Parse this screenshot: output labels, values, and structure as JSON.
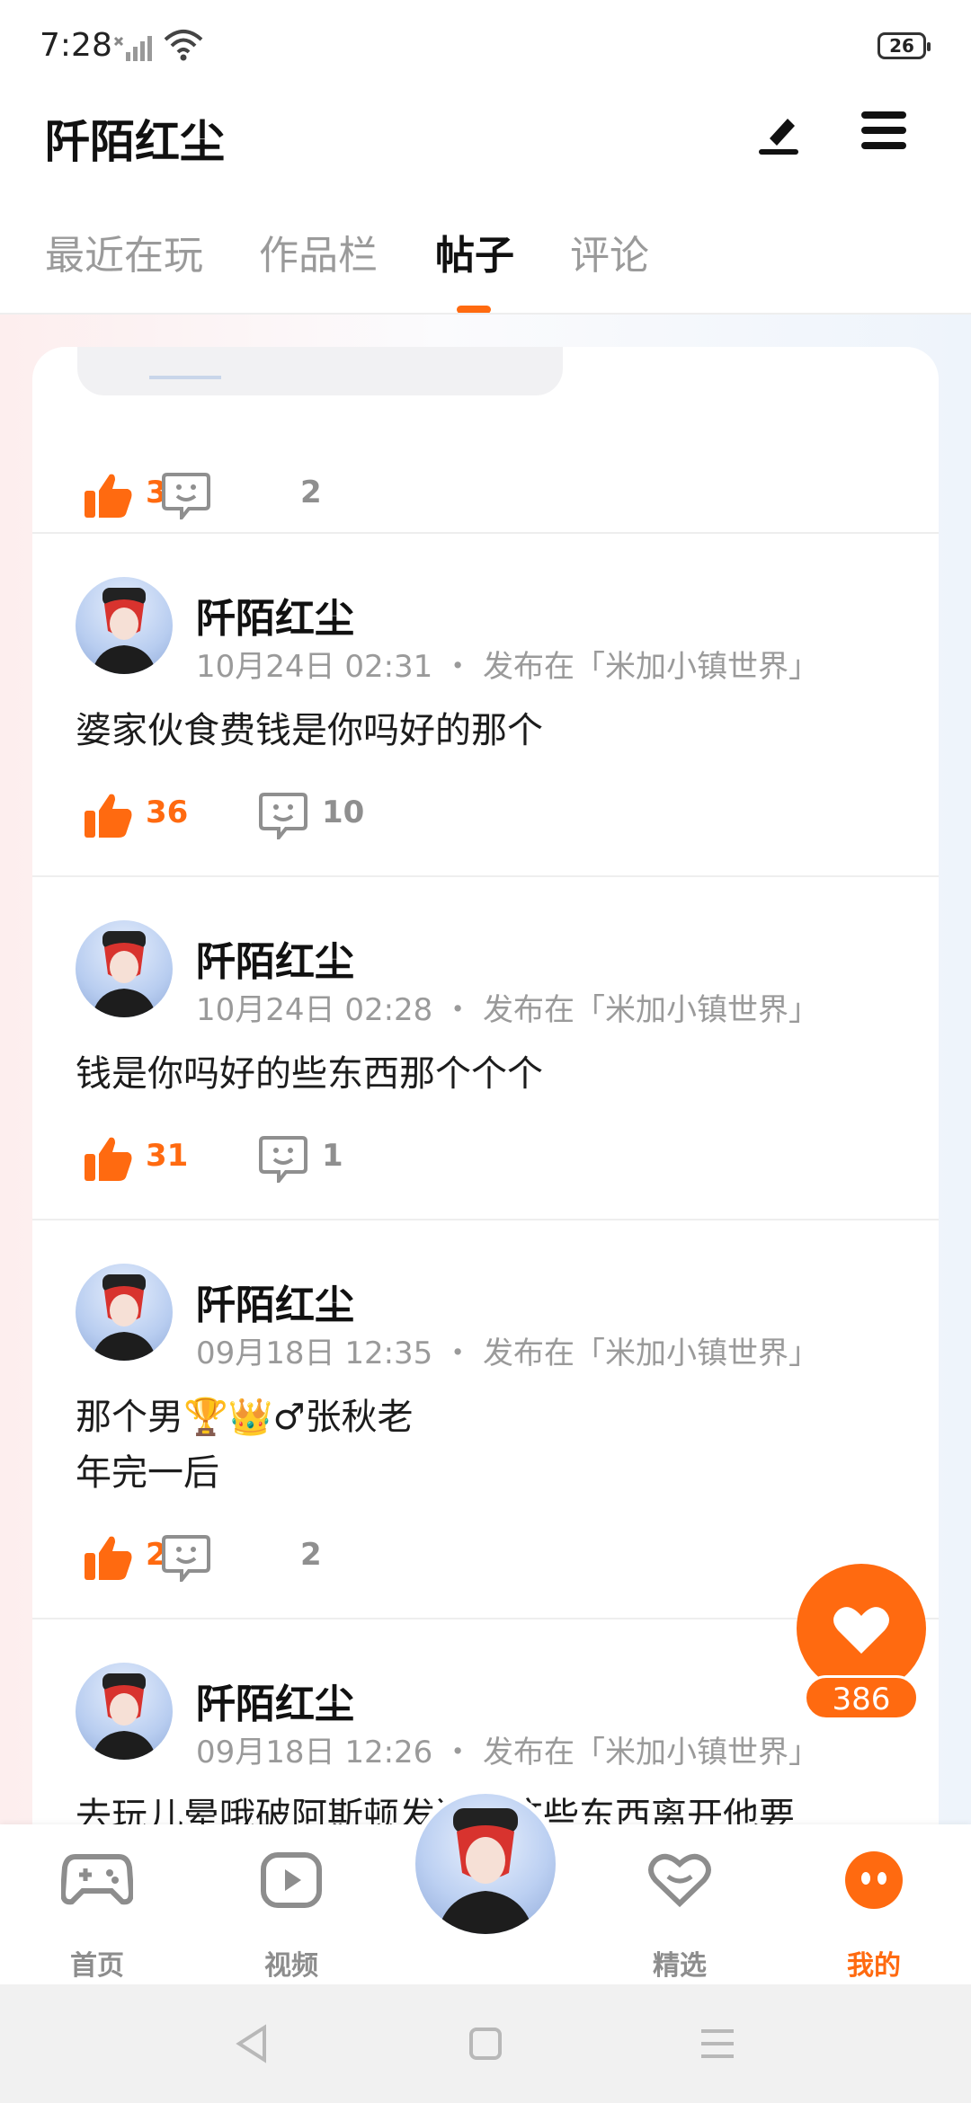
{
  "status_bar": {
    "time": "7:28",
    "battery": "26"
  },
  "header": {
    "title": "阡陌红尘"
  },
  "tabs": [
    {
      "label": "最近在玩"
    },
    {
      "label": "作品栏"
    },
    {
      "label": "帖子"
    },
    {
      "label": "评论"
    }
  ],
  "top_stub": {
    "likes": "3",
    "comments": "2"
  },
  "posts": [
    {
      "author": "阡陌红尘",
      "date": "10月24日 02:31",
      "sep": "・",
      "posted_in": "发布在「米加小镇世界」",
      "lines": [
        "婆家伙食费钱是你吗好的那个"
      ],
      "likes": "36",
      "comments": "10"
    },
    {
      "author": "阡陌红尘",
      "date": "10月24日 02:28",
      "sep": "・",
      "posted_in": "发布在「米加小镇世界」",
      "lines": [
        "钱是你吗好的些东西那个个个"
      ],
      "likes": "31",
      "comments": "1"
    },
    {
      "author": "阡陌红尘",
      "date": "09月18日 12:35",
      "sep": "・",
      "posted_in": "发布在「米加小镇世界」",
      "lines": [
        "那个男🏆👑♂张秋老",
        "年完一后"
      ],
      "likes": "2",
      "comments": "2"
    },
    {
      "author": "阡陌红尘",
      "date": "09月18日 12:26",
      "sep": "・",
      "posted_in": "发布在「米加小镇世界」",
      "lines": [
        "去玩儿晕哦破阿斯顿发送看这些东西离开他要"
      ]
    }
  ],
  "floating_like": {
    "count": "386"
  },
  "bottom_nav": [
    {
      "label": "首页",
      "icon": "gamepad-icon"
    },
    {
      "label": "视频",
      "icon": "video-play-icon"
    },
    {
      "label": "精选",
      "icon": "heart-smile-icon"
    },
    {
      "label": "我的",
      "icon": "profile-face-icon",
      "active": true
    }
  ],
  "colors": {
    "accent": "#ff6a10",
    "text": "#1c1c1c",
    "muted": "#9a9a9a"
  }
}
